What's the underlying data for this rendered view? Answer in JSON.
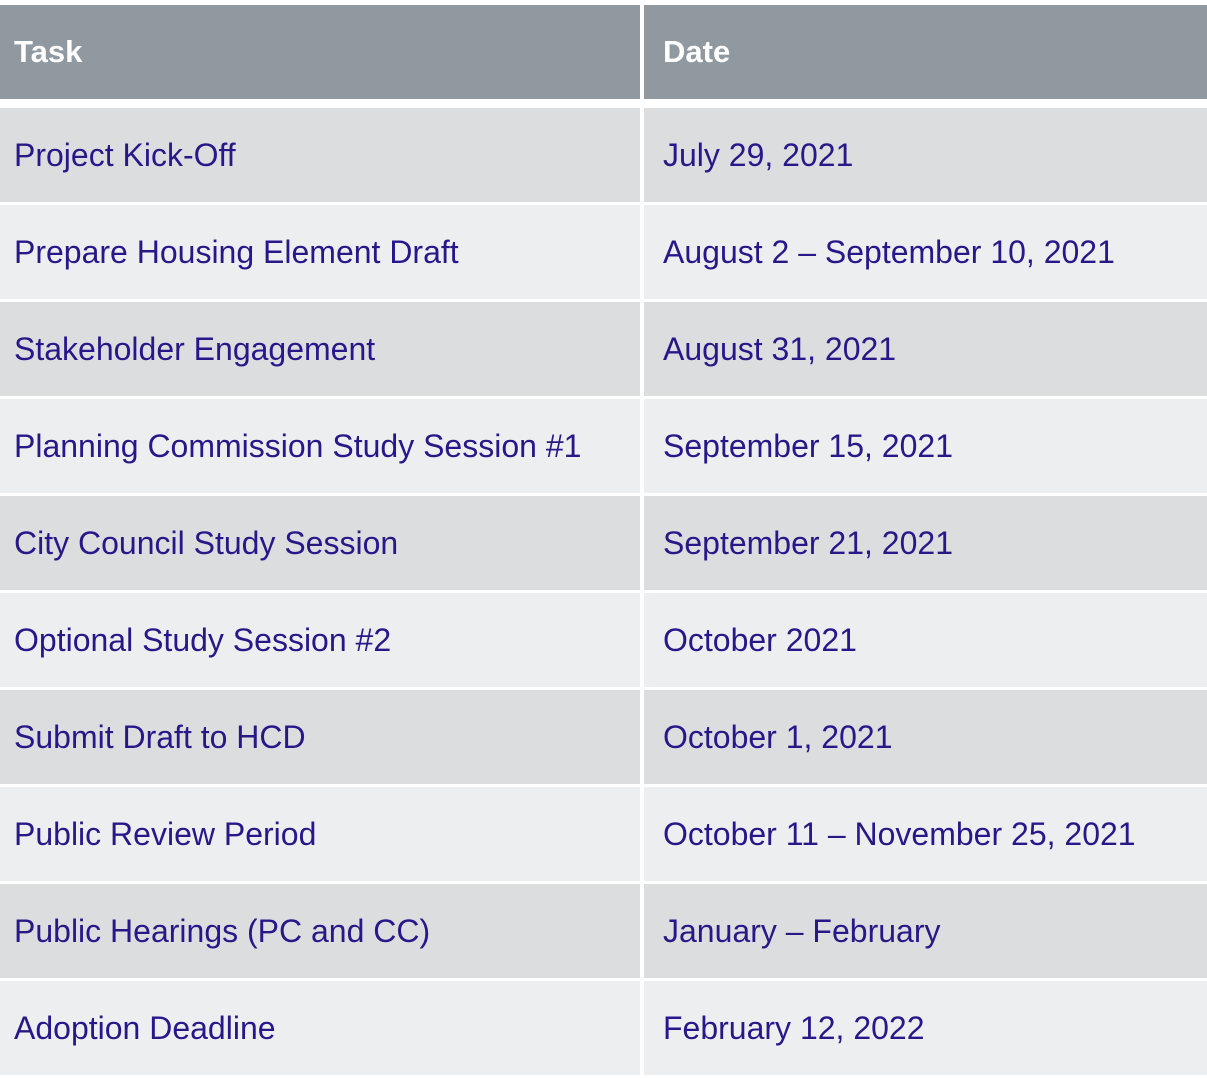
{
  "table": {
    "headers": {
      "task": "Task",
      "date": "Date"
    },
    "rows": [
      {
        "task": "Project Kick-Off",
        "date": "July 29, 2021"
      },
      {
        "task": "Prepare Housing Element Draft",
        "date": "August 2 – September 10, 2021"
      },
      {
        "task": "Stakeholder Engagement",
        "date": "August 31, 2021"
      },
      {
        "task": "Planning Commission Study Session #1",
        "date": "September 15, 2021"
      },
      {
        "task": "City Council Study Session",
        "date": "September 21, 2021"
      },
      {
        "task": "Optional Study Session #2",
        "date": "October 2021"
      },
      {
        "task": "Submit Draft to HCD",
        "date": "October 1, 2021"
      },
      {
        "task": "Public Review Period",
        "date": "October 11 – November 25, 2021"
      },
      {
        "task": "Public Hearings (PC and CC)",
        "date": "January – February"
      },
      {
        "task": "Adoption Deadline",
        "date": "February 12, 2022"
      }
    ]
  },
  "colors": {
    "header_bg": "#9199a0",
    "row_odd": "#dcdddf",
    "row_even": "#edeef0",
    "text": "#27188a"
  }
}
